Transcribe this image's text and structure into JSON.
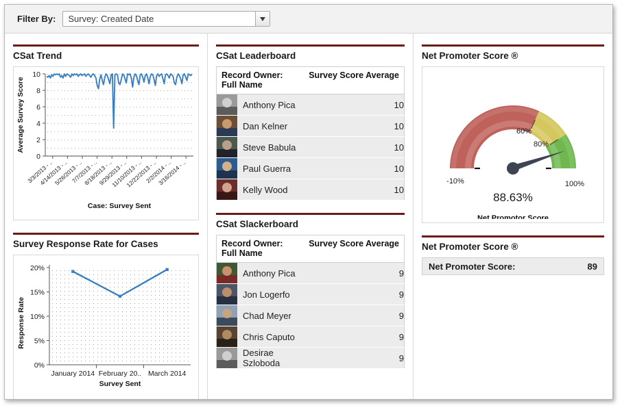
{
  "filter": {
    "label": "Filter By:",
    "value": "Survey: Created Date",
    "caret_icon": "chevron-down-icon"
  },
  "components": {
    "csat_trend": {
      "title": "CSat Trend"
    },
    "response_rate": {
      "title": "Survey Response Rate for Cases"
    },
    "leaderboard": {
      "title": "CSat Leaderboard",
      "columns": [
        "Record Owner: Full Name",
        "Survey Score Average"
      ],
      "rows": [
        {
          "name": "Anthony Pica",
          "score": "10"
        },
        {
          "name": "Dan Kelner",
          "score": "10"
        },
        {
          "name": "Steve Babula",
          "score": "10"
        },
        {
          "name": "Paul Guerra",
          "score": "10"
        },
        {
          "name": "Kelly Wood",
          "score": "10"
        }
      ]
    },
    "slackerboard": {
      "title": "CSat Slackerboard",
      "columns": [
        "Record Owner: Full Name",
        "Survey Score Average"
      ],
      "rows": [
        {
          "name": "Anthony Pica",
          "score": "9"
        },
        {
          "name": "Jon Logerfo",
          "score": "9"
        },
        {
          "name": "Chad Meyer",
          "score": "9"
        },
        {
          "name": "Chris Caputo",
          "score": "9"
        },
        {
          "name": "Desirae Szloboda",
          "score": "9"
        }
      ]
    },
    "nps_gauge": {
      "title": "Net Promoter Score ®"
    },
    "nps_value": {
      "title": "Net Promoter Score ®",
      "label": "Net Promoter Score:",
      "value": "89"
    }
  },
  "colors": {
    "rule": "#6b1a16",
    "line": "#3a7fc1",
    "gauge_red": "#c0625c",
    "gauge_yellow": "#d4c75e",
    "gauge_green": "#6fb84f",
    "needle": "#3d4452",
    "row_bg": "#ececec"
  },
  "chart_data": [
    {
      "type": "line",
      "name": "csat-trend",
      "title": "CSat Trend",
      "xlabel": "Case: Survey Sent",
      "ylabel": "Average Survey Score",
      "ylim": [
        0,
        10
      ],
      "yticks": [
        "0",
        "2",
        "4",
        "6",
        "8",
        "10"
      ],
      "grid": true,
      "xtick_labels": [
        "3/3/2013 - ..",
        "4/14/2013 - ..",
        "5/26/2013 - ..",
        "7/7/2013 - ..",
        "8/18/2013 - ..",
        "9/29/2013 - ..",
        "11/10/2013 - ..",
        "12/22/2013 - ..",
        "2/2/2014 - ..",
        "3/16/2014 - .."
      ],
      "values": [
        9.7,
        9.6,
        9.8,
        9.5,
        9.9,
        9.7,
        10.0,
        9.9,
        10.0,
        9.9,
        10.0,
        9.6,
        9.8,
        9.5,
        10.0,
        9.7,
        10.0,
        9.9,
        9.8,
        9.6,
        10.0,
        9.8,
        10.0,
        9.9,
        10.0,
        9.7,
        9.9,
        10.0,
        9.8,
        9.9,
        10.0,
        9.7,
        9.9,
        10.0,
        9.8,
        9.6,
        9.9,
        10.0,
        9.8,
        9.5,
        8.6,
        8.2,
        9.4,
        9.9,
        9.2,
        8.7,
        9.6,
        10.0,
        9.8,
        9.3,
        8.8,
        9.9,
        10.0,
        3.4,
        9.9,
        10.0,
        9.9,
        8.9,
        8.7,
        9.3,
        10.0,
        9.9,
        9.4,
        8.9,
        10.0,
        9.9,
        10.0,
        9.5,
        8.4,
        9.6,
        10.0,
        9.8,
        9.2,
        8.7,
        9.9,
        10.0,
        9.6,
        9.0,
        9.8,
        10.0,
        9.5,
        8.8,
        9.7,
        10.0,
        9.9,
        9.3,
        8.6,
        9.8,
        10.0,
        9.7,
        9.9,
        10.0,
        9.4,
        8.8,
        9.9,
        10.0,
        9.8,
        9.5,
        10.0,
        9.9,
        9.7,
        8.9,
        8.7,
        9.6,
        10.0,
        9.8,
        9.4,
        8.8,
        9.9,
        10.0,
        9.6,
        9.2,
        10.0,
        9.9,
        9.8,
        10.0
      ]
    },
    {
      "type": "line",
      "name": "survey-response-rate",
      "title": "Survey Response Rate for Cases",
      "xlabel": "Survey Sent",
      "ylabel": "Response Rate",
      "ylim": [
        0,
        20
      ],
      "yticks": [
        "0%",
        "5%",
        "10%",
        "15%",
        "20%"
      ],
      "grid": true,
      "categories": [
        "January 2014",
        "February 20..",
        "March 2014"
      ],
      "values": [
        19.2,
        14.1,
        19.6
      ]
    },
    {
      "type": "gauge",
      "name": "net-promoter-score-gauge",
      "title": "Net Promotor Score",
      "value": 88.63,
      "value_label": "88.63%",
      "min": -10,
      "max": 100,
      "min_label": "-10%",
      "max_label": "100%",
      "breakpoints": [
        {
          "value": 60,
          "label": "60%"
        },
        {
          "value": 80,
          "label": "80%"
        }
      ],
      "bands": [
        {
          "from": -10,
          "to": 60,
          "color": "#c0625c"
        },
        {
          "from": 60,
          "to": 80,
          "color": "#d4c75e"
        },
        {
          "from": 80,
          "to": 100,
          "color": "#6fb84f"
        }
      ]
    }
  ]
}
